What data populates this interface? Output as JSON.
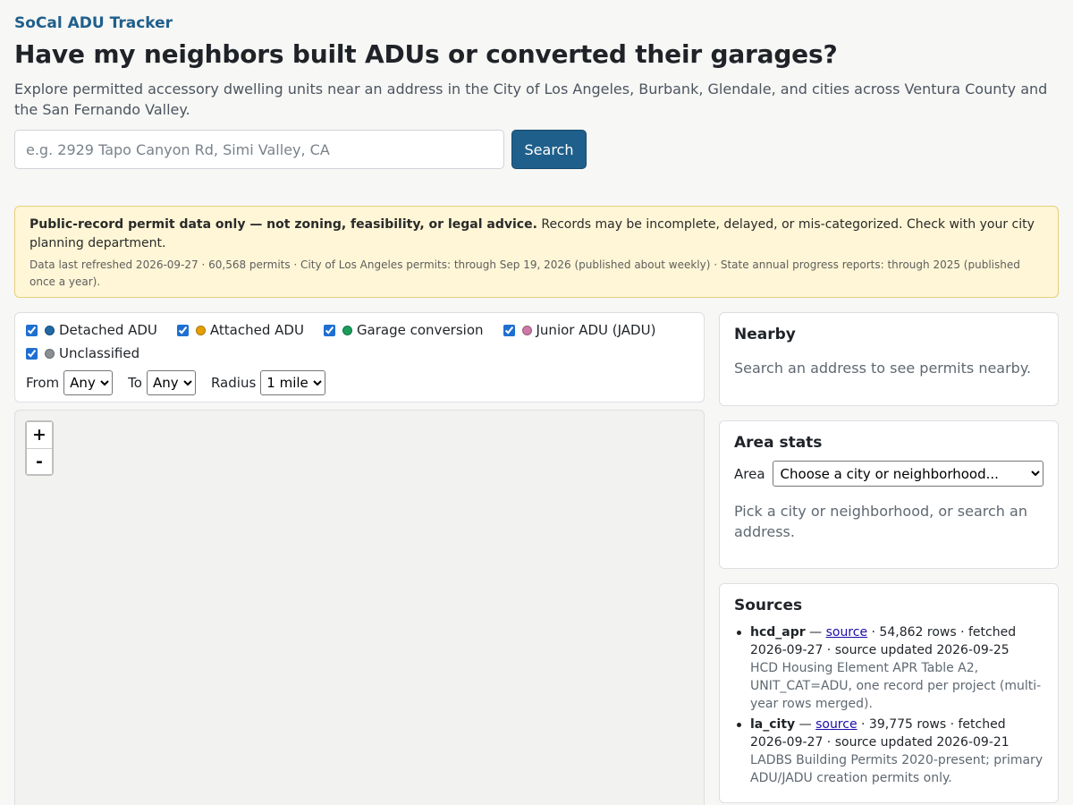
{
  "header": {
    "brand": "SoCal ADU Tracker",
    "headline": "Have my neighbors built ADUs or converted their garages?",
    "lede": "Explore permitted accessory dwelling units near an address in the City of Los Angeles, Burbank, Glendale, and cities across Ventura County and the San Fernando Valley."
  },
  "search": {
    "placeholder": "e.g. 2929 Tapo Canyon Rd, Simi Valley, CA",
    "value": "",
    "button_label": "Search"
  },
  "notice": {
    "bold_text": "Public-record permit data only — not zoning, feasibility, or legal advice.",
    "text": " Records may be incomplete, delayed, or mis-categorized. Check with your city planning department.",
    "meta": "Data last refreshed 2026-09-27 · 60,568 permits · City of Los Angeles permits: through Sep 19, 2026 (published about weekly) · State annual progress reports: through 2025 (published once a year)."
  },
  "filters": {
    "categories": [
      {
        "label": "Detached ADU",
        "color": "#1f6aa5",
        "checked": true
      },
      {
        "label": "Attached ADU",
        "color": "#e69f00",
        "checked": true
      },
      {
        "label": "Garage conversion",
        "color": "#1a9e5c",
        "checked": true
      },
      {
        "label": "Junior ADU (JADU)",
        "color": "#cc79a7",
        "checked": true
      },
      {
        "label": "Unclassified",
        "color": "#8a8f94",
        "checked": true
      }
    ],
    "from_label": "From",
    "from_value": "Any",
    "to_label": "To",
    "to_value": "Any",
    "radius_label": "Radius",
    "radius_value": "1 mile"
  },
  "map": {
    "zoom_in": "+",
    "zoom_out": "-"
  },
  "nearby": {
    "title": "Nearby",
    "message": "Search an address to see permits nearby."
  },
  "stats": {
    "title": "Area stats",
    "area_label": "Area",
    "area_placeholder": "Choose a city or neighborhood...",
    "message": "Pick a city or neighborhood, or search an address."
  },
  "sources": {
    "title": "Sources",
    "items": [
      {
        "name": "hcd_apr",
        "sep": " — ",
        "link": "source",
        "info": " · 54,862 rows · fetched 2026-09-27 · source updated 2026-09-25",
        "desc": "HCD Housing Element APR Table A2, UNIT_CAT=ADU, one record per project (multi-year rows merged)."
      },
      {
        "name": "la_city",
        "sep": " — ",
        "link": "source",
        "info": " · 39,775 rows · fetched 2026-09-27 · source updated 2026-09-21",
        "desc": "LADBS Building Permits 2020-present; primary ADU/JADU creation permits only."
      }
    ]
  }
}
